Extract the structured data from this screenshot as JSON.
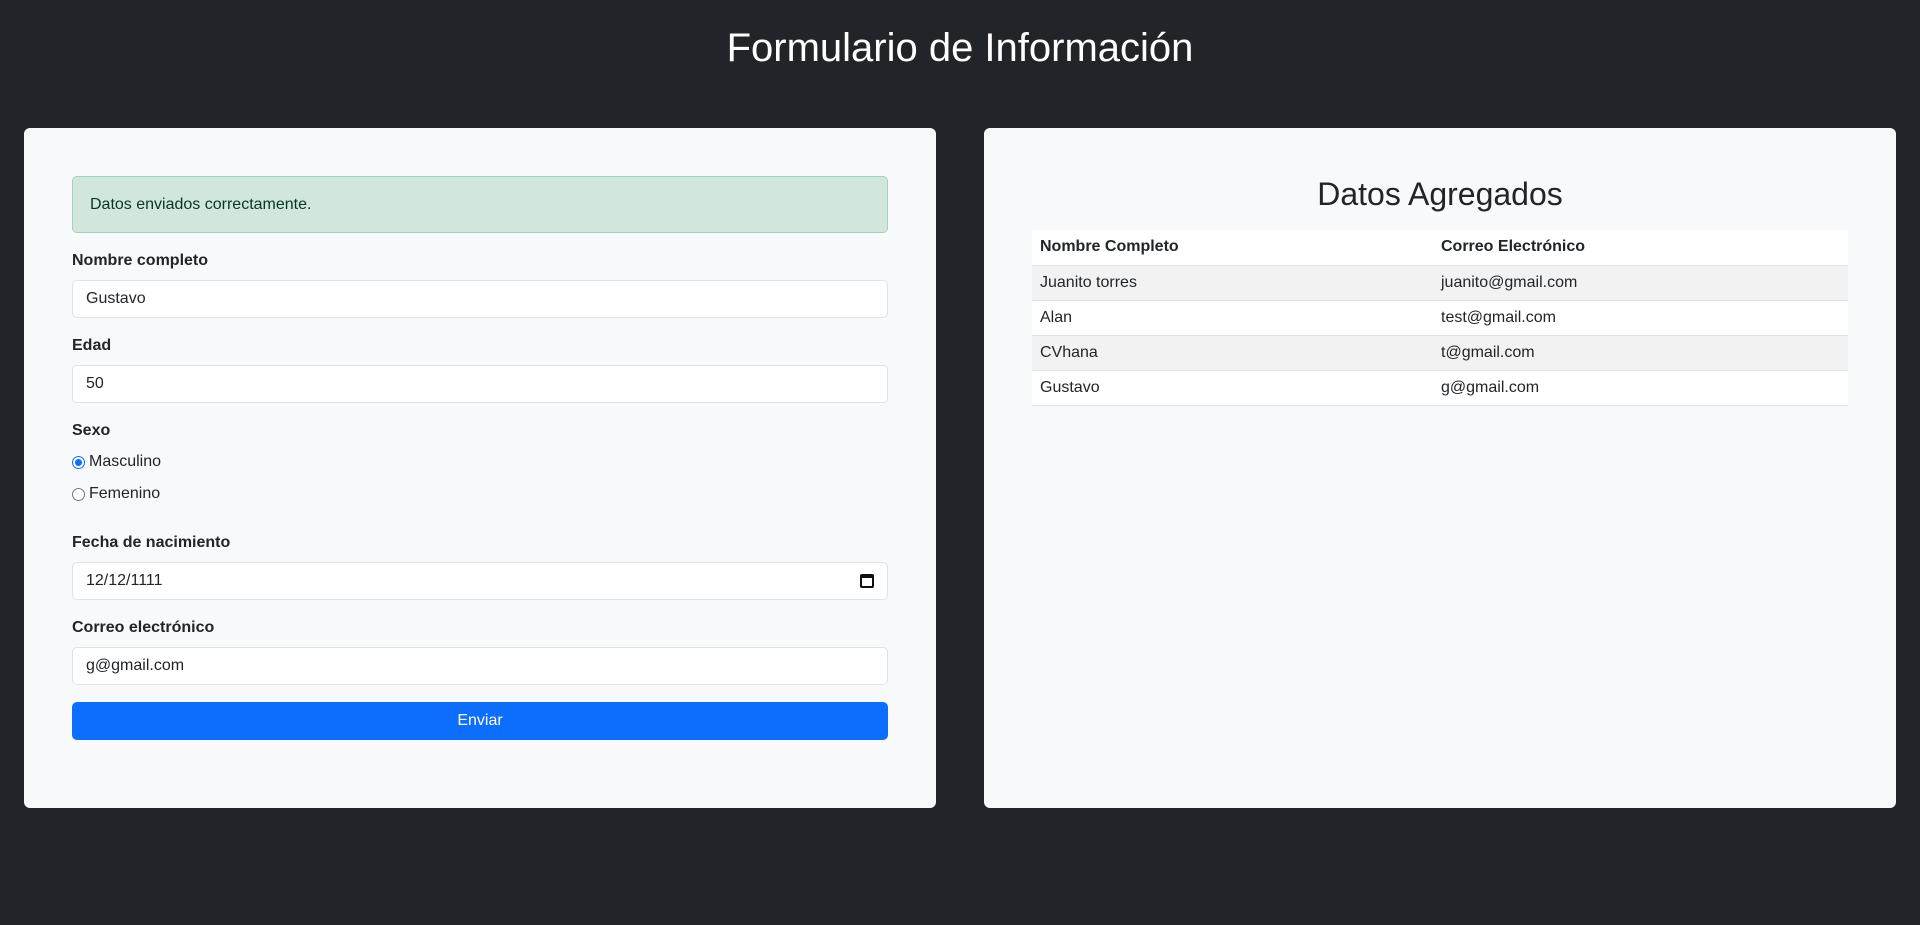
{
  "header": {
    "title": "Formulario de Información"
  },
  "form": {
    "alert": "Datos enviados correctamente.",
    "nombre": {
      "label": "Nombre completo",
      "value": "Gustavo"
    },
    "edad": {
      "label": "Edad",
      "value": "50"
    },
    "sexo": {
      "label": "Sexo",
      "options": [
        {
          "label": "Masculino",
          "checked": true
        },
        {
          "label": "Femenino",
          "checked": false
        }
      ]
    },
    "fecha": {
      "label": "Fecha de nacimiento",
      "value": "12/12/1111",
      "icon": "calendar-icon"
    },
    "correo": {
      "label": "Correo electrónico",
      "value": "g@gmail.com"
    },
    "submit_label": "Enviar"
  },
  "table": {
    "title": "Datos Agregados",
    "headers": [
      "Nombre Completo",
      "Correo Electrónico"
    ],
    "rows": [
      [
        "Juanito torres",
        "juanito@gmail.com"
      ],
      [
        "Alan",
        "test@gmail.com"
      ],
      [
        "CVhana",
        "t@gmail.com"
      ],
      [
        "Gustavo",
        "g@gmail.com"
      ]
    ]
  },
  "colors": {
    "background": "#212529",
    "card": "#f8f9fa",
    "primary": "#0d6efd",
    "alert_bg": "#d1e7dd",
    "alert_text": "#0a3622"
  }
}
